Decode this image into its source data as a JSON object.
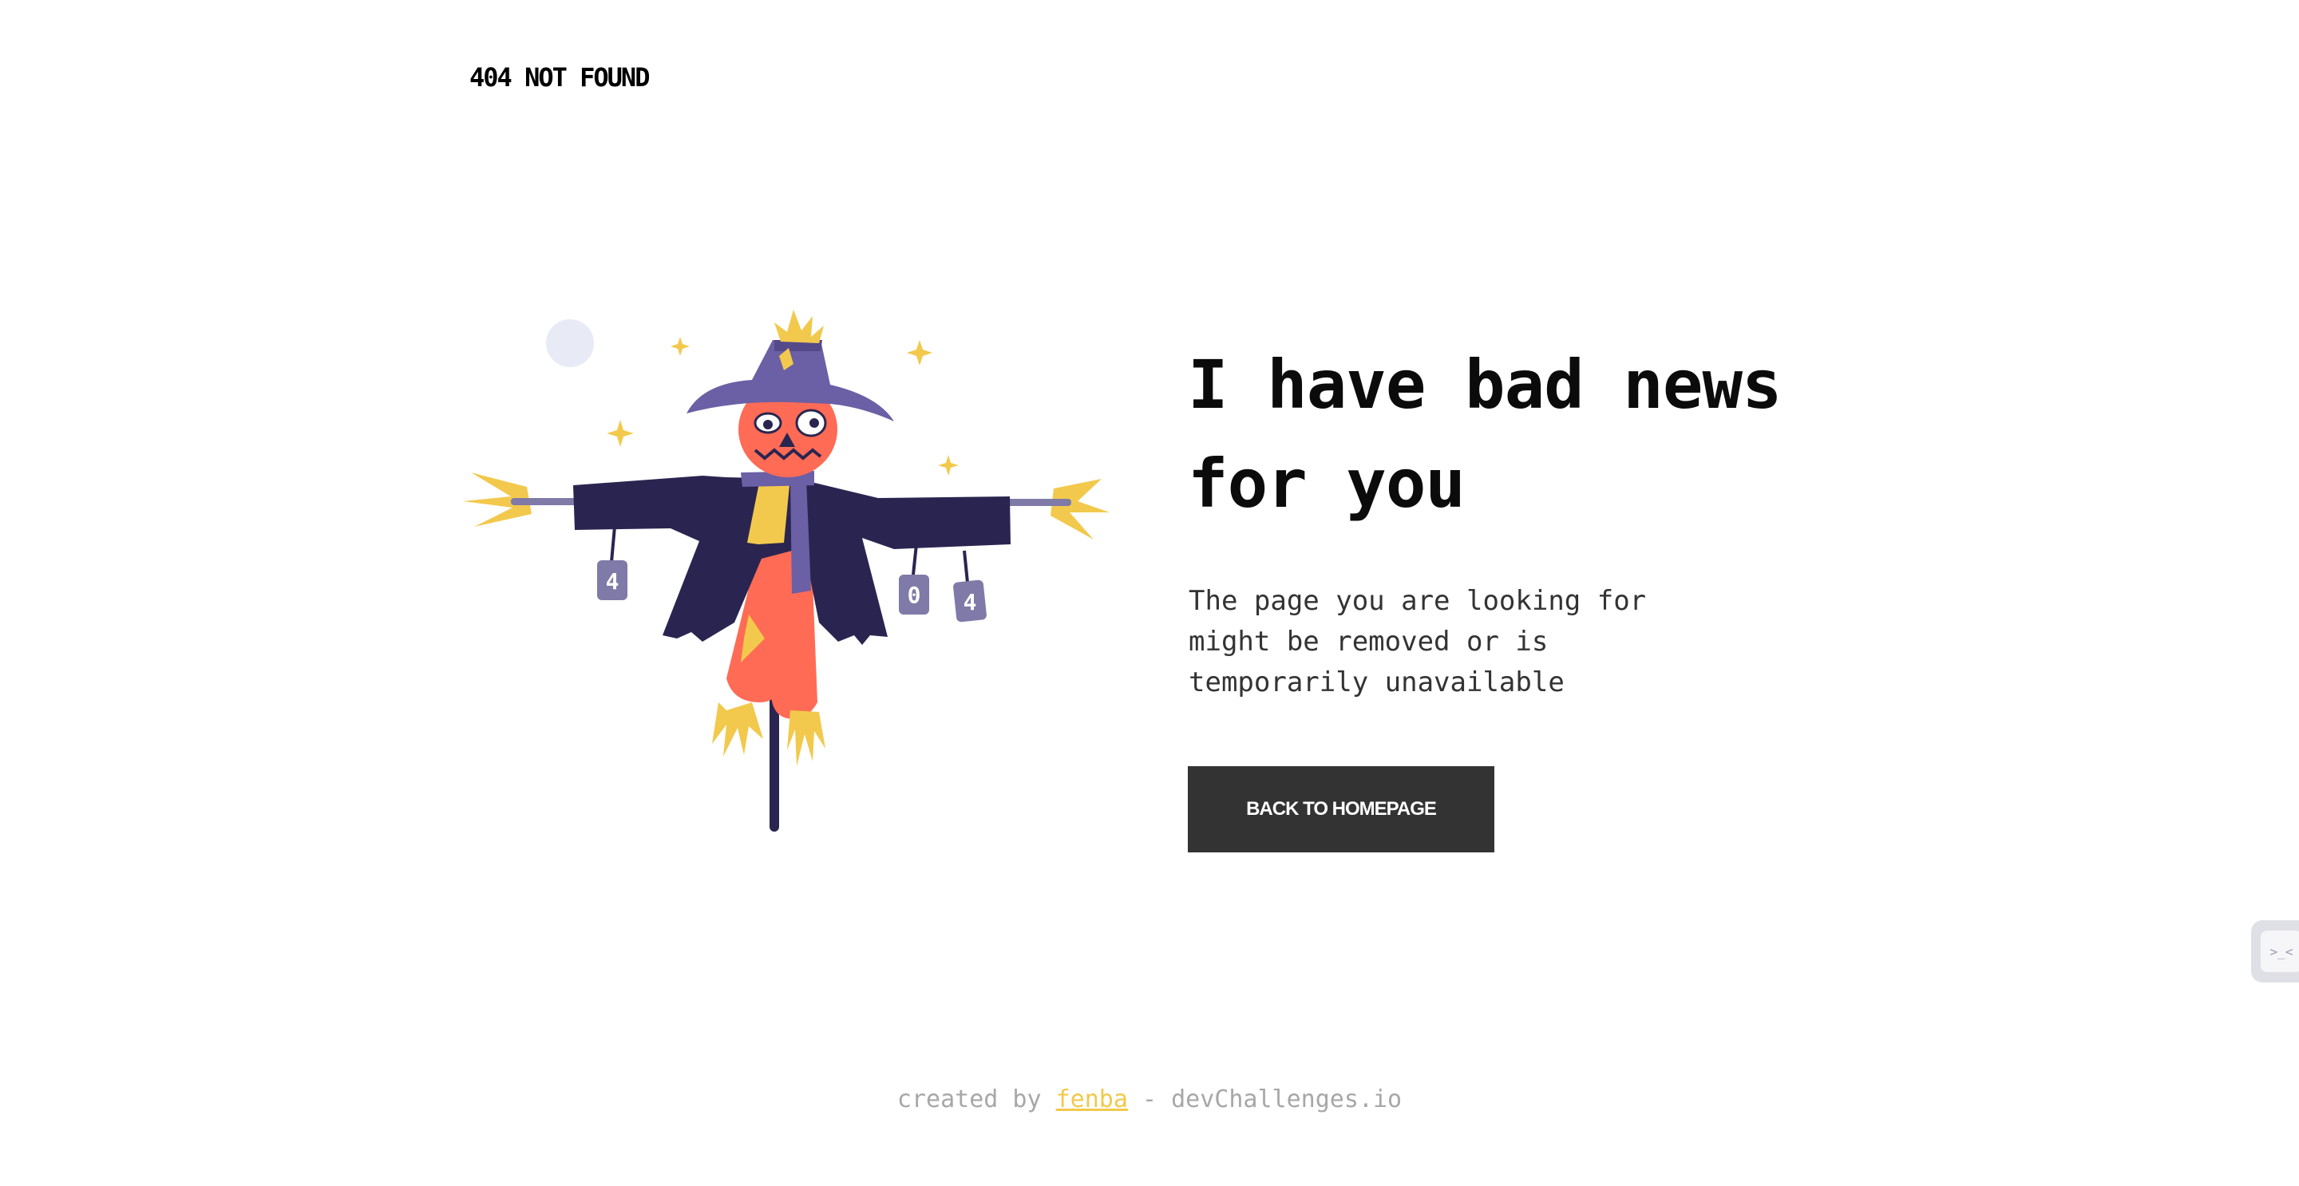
{
  "header": {
    "logo": "404 NOT FOUND"
  },
  "main": {
    "headline_line1": "I have bad news",
    "headline_line2": "for you",
    "description_line1": "The page you are looking for",
    "description_line2": "might be removed or is",
    "description_line3": "temporarily unavailable",
    "cta_label": "BACK TO HOMEPAGE"
  },
  "illustration": {
    "can_labels": [
      "4",
      "0",
      "4"
    ]
  },
  "footer": {
    "prefix": "created by",
    "author": "fenba",
    "suffix": "- devChallenges.io"
  },
  "widget": {
    "icon": "terminal-icon",
    "glyph": ">_<"
  },
  "colors": {
    "button_bg": "#333333",
    "link": "#f2c94c",
    "footer_text": "#a7a7a7"
  }
}
